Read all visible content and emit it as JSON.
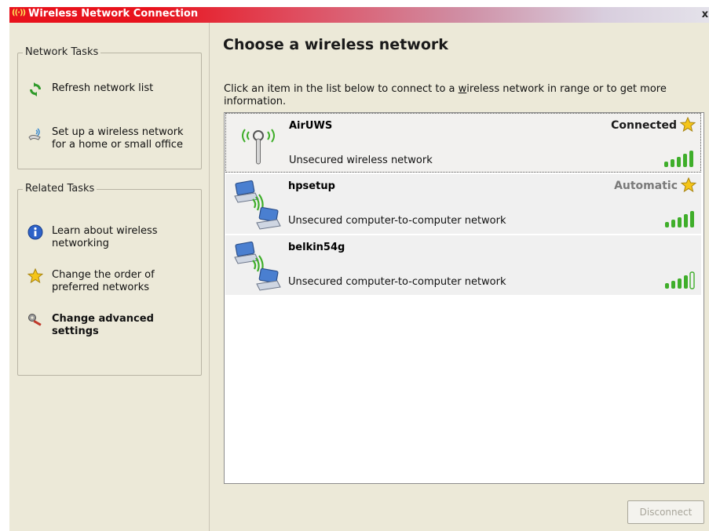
{
  "window": {
    "title": "Wireless Network Connection",
    "close_glyph": "x"
  },
  "network_tasks": {
    "legend": "Network Tasks",
    "items": [
      {
        "label": "Refresh network list",
        "icon": "refresh-icon"
      },
      {
        "label": "Set up a wireless network\nfor a home or small office",
        "icon": "setup-network-icon"
      }
    ]
  },
  "related_tasks": {
    "legend": "Related Tasks",
    "items": [
      {
        "label": "Learn about wireless\nnetworking",
        "icon": "info-icon"
      },
      {
        "label": "Change the order of\npreferred networks",
        "icon": "star-icon"
      },
      {
        "label": "Change advanced\nsettings",
        "icon": "tools-icon"
      }
    ]
  },
  "main": {
    "heading": "Choose a wireless network",
    "intro_before": "Click an item in the list below to connect to a ",
    "intro_link": "w",
    "intro_after": "ireless network in range or to get more information."
  },
  "networks": [
    {
      "name": "AirUWS",
      "description": "Unsecured wireless network",
      "status": "Connected",
      "preferred": true,
      "signal_bars": 5,
      "type": "access-point"
    },
    {
      "name": "hpsetup",
      "description": "Unsecured computer-to-computer network",
      "status": "Automatic",
      "preferred": true,
      "signal_bars": 5,
      "type": "ad-hoc"
    },
    {
      "name": "belkin54g",
      "description": "Unsecured computer-to-computer network",
      "status": "",
      "preferred": false,
      "signal_bars": 4,
      "type": "ad-hoc"
    }
  ],
  "buttons": {
    "disconnect": "Disconnect"
  },
  "colors": {
    "title_bar_start": "#e8121c",
    "panel_bg": "#ece9d8",
    "signal_green": "#3fae2a",
    "star_yellow": "#f5c518"
  }
}
